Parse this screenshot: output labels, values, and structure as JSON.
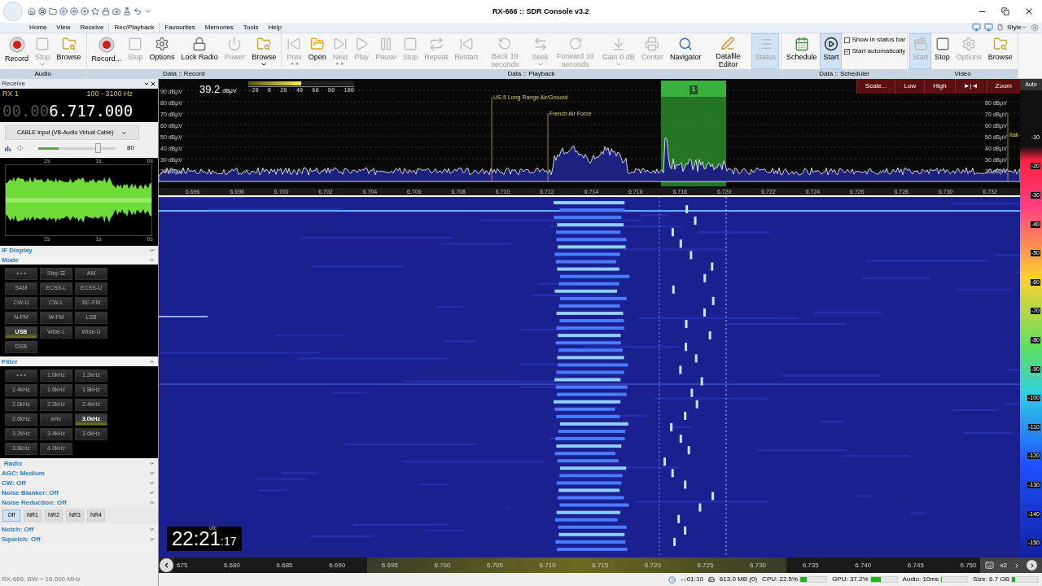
{
  "window": {
    "title": "RX-666 :: SDR Console v3.2"
  },
  "menu": [
    {
      "label": "Home",
      "selected": false
    },
    {
      "label": "View",
      "selected": false
    },
    {
      "label": "Receive",
      "selected": false
    },
    {
      "label": "Rec/Playback",
      "selected": true
    },
    {
      "label": "Favourites",
      "selected": false
    },
    {
      "label": "Memories",
      "selected": false
    },
    {
      "label": "Tools",
      "selected": false
    },
    {
      "label": "Help",
      "selected": false
    }
  ],
  "style_menu": "Style",
  "ribbon": [
    {
      "label": "Audio",
      "buttons": [
        {
          "label": "Record",
          "kind": "audio_record",
          "disabled": false,
          "active": false,
          "menu": false
        },
        {
          "label": "Stop",
          "kind": "stop",
          "disabled": true,
          "active": false,
          "menu": true
        },
        {
          "label": "Browse",
          "kind": "browse",
          "disabled": false,
          "active": false,
          "menu": false
        }
      ]
    },
    {
      "label": "Data :: Record",
      "buttons": [
        {
          "label": "Record...",
          "kind": "record",
          "disabled": false,
          "active": false,
          "menu": false
        },
        {
          "label": "Stop",
          "kind": "stop",
          "disabled": true,
          "active": false,
          "menu": false
        },
        {
          "label": "Options",
          "kind": "options",
          "disabled": false,
          "active": false,
          "menu": false
        },
        {
          "label": "Lock Radio",
          "kind": "lock",
          "disabled": false,
          "active": false,
          "menu": false
        },
        {
          "label": "Power",
          "kind": "power",
          "disabled": true,
          "active": false,
          "menu": false
        },
        {
          "label": "Browse",
          "kind": "browse",
          "disabled": false,
          "active": false,
          "menu": true
        }
      ]
    },
    {
      "label": "Data :: Playback",
      "buttons": [
        {
          "label": "Prev",
          "sub": "◄◄",
          "kind": "prev",
          "disabled": true,
          "active": false,
          "menu": false
        },
        {
          "label": "Open",
          "kind": "open",
          "disabled": false,
          "active": false,
          "menu": false
        },
        {
          "label": "Next",
          "sub": "►►",
          "kind": "next",
          "disabled": true,
          "active": false,
          "menu": false
        },
        {
          "label": "Play",
          "kind": "play",
          "disabled": true,
          "active": false,
          "menu": false
        },
        {
          "label": "Pause",
          "kind": "pause",
          "disabled": true,
          "active": false,
          "menu": false
        },
        {
          "label": "Stop",
          "kind": "stop",
          "disabled": true,
          "active": false,
          "menu": false
        },
        {
          "label": "Repeat",
          "kind": "repeat",
          "disabled": true,
          "active": false,
          "menu": false
        },
        {
          "label": "Restart",
          "kind": "restart",
          "disabled": true,
          "active": false,
          "menu": false
        },
        {
          "label": "Back 10 seconds",
          "kind": "back",
          "disabled": true,
          "active": false,
          "menu": false
        },
        {
          "label": "Seek",
          "kind": "seek",
          "disabled": true,
          "active": false,
          "menu": true
        },
        {
          "label": "Forward 10 seconds",
          "kind": "forward",
          "disabled": true,
          "active": false,
          "menu": false
        },
        {
          "label": "Gain 0 dB",
          "kind": "gain",
          "disabled": true,
          "active": false,
          "menu": true
        },
        {
          "label": "Center",
          "kind": "center",
          "disabled": true,
          "active": false,
          "menu": false
        },
        {
          "label": "Navigator",
          "kind": "navigator",
          "disabled": false,
          "active": false,
          "menu": false
        },
        {
          "label": "Datafile Editor",
          "kind": "editor",
          "disabled": false,
          "active": false,
          "menu": false
        },
        {
          "label": "Status",
          "kind": "status",
          "disabled": true,
          "active": true,
          "menu": false
        }
      ]
    },
    {
      "label": "Data :: Scheduler",
      "buttons": [
        {
          "label": "Schedule",
          "kind": "schedule",
          "disabled": false,
          "active": false,
          "menu": false
        },
        {
          "label": "Start",
          "kind": "start",
          "disabled": false,
          "active": true,
          "menu": false
        }
      ],
      "checkboxes": [
        {
          "label": "Show in status bar",
          "checked": false
        },
        {
          "label": "Start automatically",
          "checked": true
        }
      ]
    },
    {
      "label": "Video",
      "buttons": [
        {
          "label": "Start",
          "kind": "video",
          "disabled": true,
          "active": true,
          "menu": false
        },
        {
          "label": "Stop",
          "kind": "stop",
          "disabled": false,
          "active": false,
          "menu": false
        },
        {
          "label": "Options",
          "kind": "options",
          "disabled": true,
          "active": false,
          "menu": false
        },
        {
          "label": "Browse",
          "kind": "browse",
          "disabled": false,
          "active": false,
          "menu": false
        }
      ]
    }
  ],
  "receive": {
    "title": "Receive",
    "rx": "RX 1",
    "bandwidth": "100 - 3100 Hz",
    "freq_prefix": "00.00",
    "freq": "6.717.000",
    "device": "CABLE Input (VB-Audio Virtual Cable)",
    "volume": {
      "level": 0.8,
      "reading": "80"
    },
    "scope_labels_top": [
      "2s",
      "1s",
      "0s"
    ],
    "scope_labels_bottom": [
      "2s",
      "1s",
      "0s"
    ]
  },
  "sections": [
    {
      "label": "IF Display",
      "kind": "plain",
      "expanded": false
    },
    {
      "label": "Mode",
      "kind": "grid",
      "expanded": true,
      "buttons": [
        {
          "label": "• • •",
          "selected": false
        },
        {
          "label": "Step ☰",
          "selected": false
        },
        {
          "label": "AM",
          "selected": false
        },
        {
          "label": "SAM",
          "selected": false
        },
        {
          "label": "ECSS-L",
          "selected": false
        },
        {
          "label": "ECSS-U",
          "selected": false
        },
        {
          "label": "CW-U",
          "selected": false
        },
        {
          "label": "CW-L",
          "selected": false
        },
        {
          "label": "BC-FM",
          "selected": false
        },
        {
          "label": "N-FM",
          "selected": false
        },
        {
          "label": "W-FM",
          "selected": false
        },
        {
          "label": "LSB",
          "selected": false
        },
        {
          "label": "USB",
          "selected": true
        },
        {
          "label": "Wide-L",
          "selected": false
        },
        {
          "label": "Wide-U",
          "selected": false
        },
        {
          "label": "DSB",
          "selected": false
        }
      ]
    },
    {
      "label": "Filter",
      "kind": "grid",
      "expanded": true,
      "buttons": [
        {
          "label": "• • •",
          "selected": false
        },
        {
          "label": "1.0kHz",
          "selected": false
        },
        {
          "label": "1.2kHz",
          "selected": false
        },
        {
          "label": "1.4kHz",
          "selected": false
        },
        {
          "label": "1.6kHz",
          "selected": false
        },
        {
          "label": "1.8kHz",
          "selected": false
        },
        {
          "label": "2.0kHz",
          "selected": false
        },
        {
          "label": "2.2kHz",
          "selected": false
        },
        {
          "label": "2.4kHz",
          "selected": false
        },
        {
          "label": "2.6kHz",
          "selected": false
        },
        {
          "label": "kHz",
          "selected": false
        },
        {
          "label": "3.0kHz",
          "selected": true
        },
        {
          "label": "3.2kHz",
          "selected": false
        },
        {
          "label": "3.4kHz",
          "selected": false
        },
        {
          "label": "3.6kHz",
          "selected": false
        },
        {
          "label": "3.8kHz",
          "selected": false
        },
        {
          "label": "4.0kHz",
          "selected": false
        }
      ]
    },
    {
      "label": "Radio",
      "kind": "plain",
      "expanded": false
    },
    {
      "label": "AGC: Medium",
      "kind": "plain",
      "expanded": false
    },
    {
      "label": "CW: Off",
      "kind": "plain",
      "expanded": false
    },
    {
      "label": "Noise Blanker: Off",
      "kind": "plain",
      "expanded": false
    },
    {
      "label": "Noise Reduction: Off",
      "kind": "row",
      "expanded": true,
      "buttons": [
        {
          "label": "Off",
          "selected": true
        },
        {
          "label": "NR1",
          "selected": false
        },
        {
          "label": "NR2",
          "selected": false
        },
        {
          "label": "NR3",
          "selected": false
        },
        {
          "label": "NR4",
          "selected": false
        }
      ]
    },
    {
      "label": "Notch: Off",
      "kind": "plain",
      "expanded": false
    },
    {
      "label": "Squelch: Off",
      "kind": "plain",
      "expanded": false
    }
  ],
  "spectrum": {
    "signal": "39.2",
    "unit": "dBμV",
    "smeter": {
      "scale": [
        "-20",
        "0",
        "20",
        "40",
        "60",
        "80",
        "100"
      ],
      "level": 0.5
    },
    "buttons": [
      "Scale...",
      "Low",
      "High",
      "►|◄",
      "Zoom"
    ],
    "auto": "Auto",
    "y_left": [
      "90 dBμV",
      "80 dBμV",
      "70 dBμV",
      "60 dBμV",
      "50 dBμV",
      "40 dBμV",
      "30 dBμV",
      "20 dBμV"
    ],
    "y_right": [
      "80 dBμV",
      "70 dBμV",
      "60 dBμV",
      "50 dBμV",
      "40 dBμV",
      "30 dBμV",
      "20 dBμV"
    ],
    "markers": [
      {
        "label": "US-5 Long Range Air/Ground"
      },
      {
        "label": "French Air Force"
      },
      {
        "label": "Itali"
      }
    ],
    "selection": "1",
    "x_labels": [
      "6.696",
      "6.698",
      "6.700",
      "6.702",
      "6.704",
      "6.706",
      "6.708",
      "6.710",
      "6.712",
      "6.714",
      "6.716",
      "6.718",
      "6.720",
      "6.722",
      "6.724",
      "6.726",
      "6.728",
      "6.730",
      "6.732"
    ]
  },
  "waterfall": {
    "clock": {
      "hm": "22:21",
      "sec": ":17",
      "zone": "utc"
    },
    "scale": [
      "675",
      "6.680",
      "6.685",
      "6.690",
      "6.695",
      "6.700",
      "6.705",
      "6.710",
      "6.715",
      "6.720",
      "6.725",
      "6.730",
      "6.735",
      "6.740",
      "6.745",
      "6.750"
    ],
    "zoom": "x2",
    "color_scale": [
      "-10",
      "-20",
      "-30",
      "-40",
      "-50",
      "-60",
      "-70",
      "-80",
      "-90",
      "-100",
      "-110",
      "-120",
      "-130",
      "-140",
      "-150"
    ]
  },
  "status_bar": {
    "left": "RX-666, BW = 16.000 MHz",
    "time": "--:01:10",
    "memory": "613.0 MB (0)",
    "meters": [
      {
        "label": "CPU: 22.5%",
        "level": 0.22
      },
      {
        "label": "GPU: 37.2%",
        "level": 0.37
      },
      {
        "label": "Audio: 10ms",
        "level": 0.03
      },
      {
        "label": "Size: 6.7 GB",
        "level": 0.12
      }
    ]
  }
}
